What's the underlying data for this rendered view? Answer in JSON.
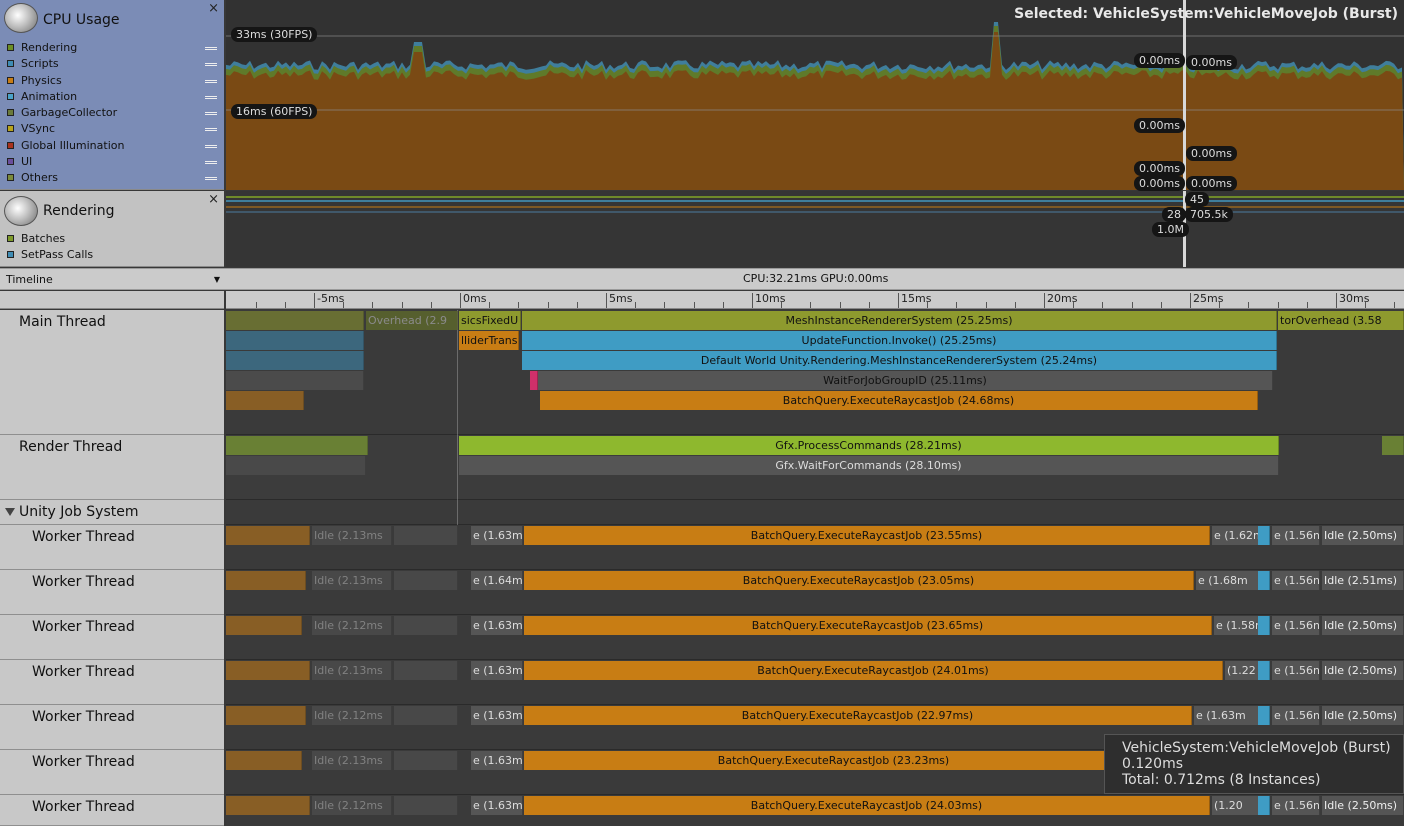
{
  "cpu_module": {
    "title": "CPU Usage",
    "close": "×",
    "legend": [
      {
        "label": "Rendering",
        "color": "#6b8e23"
      },
      {
        "label": "Scripts",
        "color": "#3f8cb4"
      },
      {
        "label": "Physics",
        "color": "#c87d14"
      },
      {
        "label": "Animation",
        "color": "#4aa3c8"
      },
      {
        "label": "GarbageCollector",
        "color": "#6a7a3a"
      },
      {
        "label": "VSync",
        "color": "#b8a41c"
      },
      {
        "label": "Global Illumination",
        "color": "#a8321e"
      },
      {
        "label": "UI",
        "color": "#6a4e9c"
      },
      {
        "label": "Others",
        "color": "#7a8a3a"
      }
    ]
  },
  "rendering_module": {
    "title": "Rendering",
    "close": "×",
    "legend": [
      {
        "label": "Batches",
        "color": "#7e9a2a"
      },
      {
        "label": "SetPass Calls",
        "color": "#3f8cb4"
      }
    ]
  },
  "cpu_chart": {
    "selected": "Selected: VehicleSystem:VehicleMoveJob (Burst)",
    "line_30fps": "33ms (30FPS)",
    "line_60fps": "16ms (60FPS)",
    "value_labels": [
      "0.00ms",
      "0.00ms",
      "0.00ms",
      "0.00ms",
      "0.00ms",
      "0.00ms",
      "0.00ms"
    ]
  },
  "render_chart": {
    "labels": [
      "45",
      "28",
      "705.5k",
      "1.0M"
    ]
  },
  "timeline_header": {
    "mode": "Timeline",
    "cpu_gpu": "CPU:32.21ms   GPU:0.00ms"
  },
  "ruler": {
    "labels": [
      "-5ms",
      "0ms",
      "5ms",
      "10ms",
      "15ms",
      "20ms",
      "25ms",
      "30ms"
    ]
  },
  "threads": {
    "main": "Main Thread",
    "render": "Render Thread",
    "job_group": "Unity Job System",
    "workers": [
      "Worker Thread",
      "Worker Thread",
      "Worker Thread",
      "Worker Thread",
      "Worker Thread",
      "Worker Thread",
      "Worker Thread"
    ]
  },
  "main_bars": {
    "overhead_left": "Overhead (2.9",
    "physics_fixed": "sicsFixedU",
    "mesh_system": "MeshInstanceRendererSystem (25.25ms)",
    "overhead_right": "torOverhead (3.58",
    "collider": "lliderTrans",
    "update_invoke": "UpdateFunction.Invoke() (25.25ms)",
    "default_world": "Default World Unity.Rendering.MeshInstanceRendererSystem (25.24ms)",
    "wait_group": "WaitForJobGroupID (25.11ms)",
    "batch_query": "BatchQuery.ExecuteRaycastJob (24.68ms)"
  },
  "render_bars": {
    "process": "Gfx.ProcessCommands (28.21ms)",
    "wait": "Gfx.WaitForCommands (28.10ms)"
  },
  "worker_bars": [
    {
      "idle_left": "Idle (2.13ms",
      "small": "e (1.63m",
      "main": "BatchQuery.ExecuteRaycastJob (23.55ms)",
      "after": "e (1.62m",
      "after2": "e (1.56n",
      "idle_right": "Idle (2.50ms)"
    },
    {
      "idle_left": "Idle (2.13ms",
      "small": "e (1.64m",
      "main": "BatchQuery.ExecuteRaycastJob (23.05ms)",
      "after": "e (1.68m",
      "after2": "e (1.56n",
      "idle_right": "Idle (2.51ms)"
    },
    {
      "idle_left": "Idle (2.12ms",
      "small": "e (1.63m",
      "main": "BatchQuery.ExecuteRaycastJob (23.65ms)",
      "after": "e (1.58m",
      "after2": "e (1.56n",
      "idle_right": "Idle (2.50ms)"
    },
    {
      "idle_left": "Idle (2.13ms",
      "small": "e (1.63m",
      "main": "BatchQuery.ExecuteRaycastJob (24.01ms)",
      "after": "(1.22",
      "after2": "e (1.56n",
      "idle_right": "Idle (2.50ms)"
    },
    {
      "idle_left": "Idle (2.12ms",
      "small": "e (1.63m",
      "main": "BatchQuery.ExecuteRaycastJob (22.97ms)",
      "after": "e (1.63m",
      "after2": "e (1.56n",
      "idle_right": "Idle (2.50ms)"
    },
    {
      "idle_left": "Idle (2.13ms",
      "small": "e (1.63m",
      "main": "BatchQuery.ExecuteRaycastJob (23.23ms)",
      "after": "",
      "after2": "",
      "idle_right": ""
    },
    {
      "idle_left": "Idle (2.12ms",
      "small": "e (1.63m",
      "main": "BatchQuery.ExecuteRaycastJob (24.03ms)",
      "after": "(1.20",
      "after2": "e (1.56n",
      "idle_right": "Idle (2.50ms)"
    }
  ],
  "tooltip": {
    "name": "VehicleSystem:VehicleMoveJob (Burst)",
    "time": "0.120ms",
    "total": "Total: 0.712ms (8 Instances)"
  }
}
